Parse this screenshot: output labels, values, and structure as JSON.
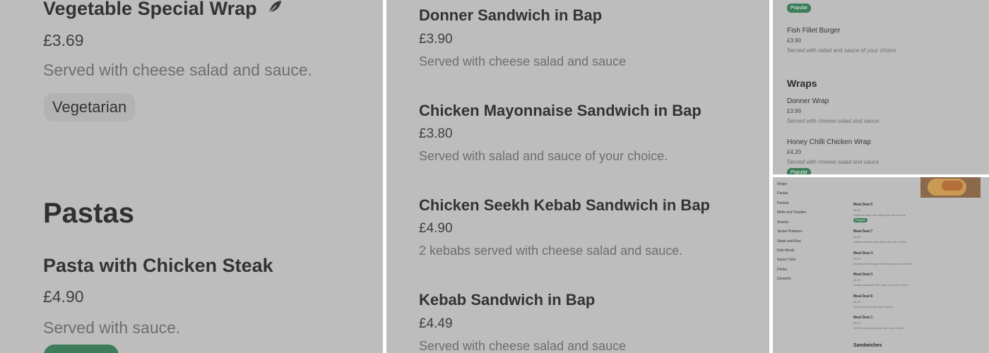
{
  "panel1": {
    "item1_name": "Vegetable Special Wrap",
    "item1_icon": "leaf-icon",
    "item1_price": "£3.69",
    "item1_desc": "Served with cheese salad and sauce.",
    "item1_badge": "Vegetarian",
    "section_heading": "Pastas",
    "item2_name": "Pasta with Chicken Steak",
    "item2_price": "£4.90",
    "item2_desc": "Served with sauce."
  },
  "panel2": {
    "items": [
      {
        "name": "Donner Sandwich in Bap",
        "price": "£3.90",
        "desc": "Served with cheese salad and sauce"
      },
      {
        "name": "Chicken Mayonnaise Sandwich in Bap",
        "price": "£3.80",
        "desc": "Served with salad and sauce of your choice."
      },
      {
        "name": "Chicken Seekh Kebab Sandwich in Bap",
        "price": "£4.90",
        "desc": "2 kebabs served with cheese salad and sauce."
      },
      {
        "name": "Kebab Sandwich in Bap",
        "price": "£4.49",
        "desc": "Served with cheese salad and sauce"
      }
    ]
  },
  "panel3": {
    "top_badge": "Popular",
    "fish_name": "Fish Fillet Burger",
    "fish_price": "£3.90",
    "fish_desc": "Served with salad and sauce of your choice",
    "section_heading": "Wraps",
    "wrap1_name": "Donner Wrap",
    "wrap1_price": "£3.99",
    "wrap1_desc": "Served with cheese salad and sauce",
    "wrap2_name": "Honey Chilli Chicken Wrap",
    "wrap2_price": "£4.20",
    "wrap2_desc": "Served with cheese salad and sauce",
    "wrap2_badge": "Popular"
  },
  "panel4": {
    "nav": [
      "Wraps",
      "Pastas",
      "Paninis",
      "Melts and Toasties",
      "Snacks",
      "Jacket Potatoes",
      "Steak and Rice",
      "Kids Meals",
      "Sauce Tubs",
      "Drinks",
      "Desserts"
    ],
    "deals": [
      {
        "name": "Meal Deal 5",
        "price": "£5.90",
        "desc": "Panini or wrap with chips and can of drink",
        "badge": "Popular"
      },
      {
        "name": "Meal Deal 7",
        "price": "£6.90",
        "desc": "Chicken breast with chips with can of drink"
      },
      {
        "name": "Meal Deal 4",
        "price": "£5.99",
        "desc": "Chicken fillet burger with chips and can of drink"
      },
      {
        "name": "Meal Deal 3",
        "price": "£6.20",
        "desc": "Kebab sandwich with chips and can of drink"
      },
      {
        "name": "Meal Deal 8",
        "price": "£6.99",
        "desc": "Steak and rice with can of drink"
      },
      {
        "name": "Meal Deal 1",
        "price": "£5.49",
        "desc": "Donner meat and chips with can of drink"
      }
    ],
    "section_heading": "Sandwiches",
    "thumbnail_icon": "food-photo-icon"
  },
  "colors": {
    "background": "#bdbdbd",
    "accent_green": "#3d7d5a"
  }
}
